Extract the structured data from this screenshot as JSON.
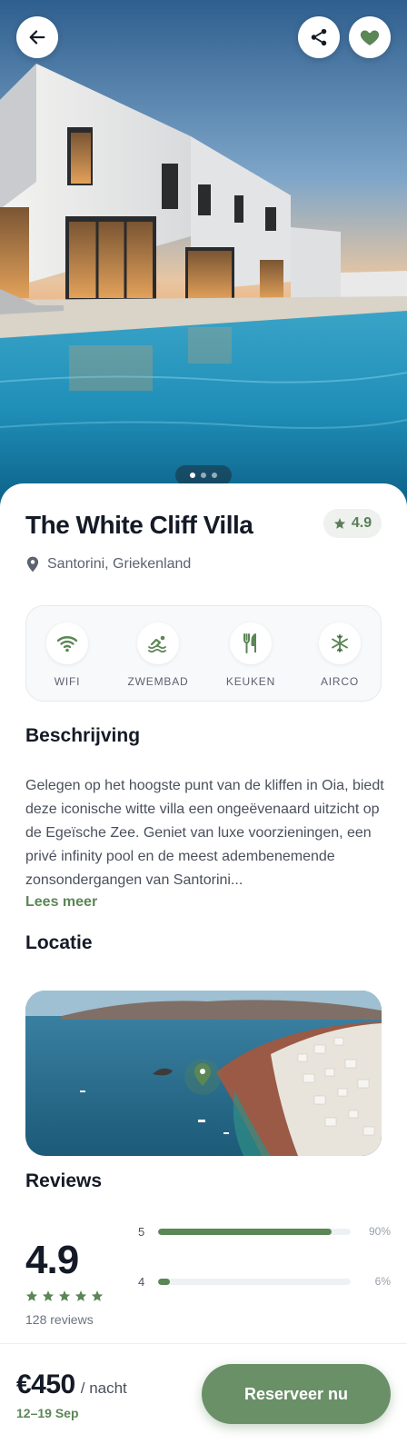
{
  "hero": {
    "carousel_total": 3,
    "carousel_active": 1
  },
  "listing": {
    "title": "The White Cliff Villa",
    "rating": "4.9",
    "location": "Santorini, Griekenland"
  },
  "amenities": [
    {
      "label": "WIFI",
      "icon": "wifi-icon"
    },
    {
      "label": "ZWEMBAD",
      "icon": "swimming-icon"
    },
    {
      "label": "KEUKEN",
      "icon": "utensils-icon"
    },
    {
      "label": "AIRCO",
      "icon": "snowflake-icon"
    }
  ],
  "description": {
    "heading": "Beschrijving",
    "text": "Gelegen op het hoogste punt van de kliffen in Oia, biedt deze iconische witte villa een ongeëvenaard uitzicht op de Egeïsche Zee. Geniet van luxe voorzieningen, een privé infinity pool en de meest adembenemende zonsondergangen van Santorini...",
    "read_more": "Lees meer"
  },
  "location_section": {
    "heading": "Locatie"
  },
  "reviews": {
    "heading": "Reviews",
    "score": "4.9",
    "stars": 5,
    "count_text": "128 reviews",
    "breakdown": [
      {
        "stars": "5",
        "percent": 90,
        "label": "90%"
      },
      {
        "stars": "4",
        "percent": 6,
        "label": "6%"
      }
    ]
  },
  "booking": {
    "price": "€450",
    "per": "/ nacht",
    "dates": "12–19 Sep",
    "cta": "Reserveer nu"
  },
  "colors": {
    "accent": "#5b8656",
    "cta": "#6a9068",
    "text": "#141a26"
  }
}
